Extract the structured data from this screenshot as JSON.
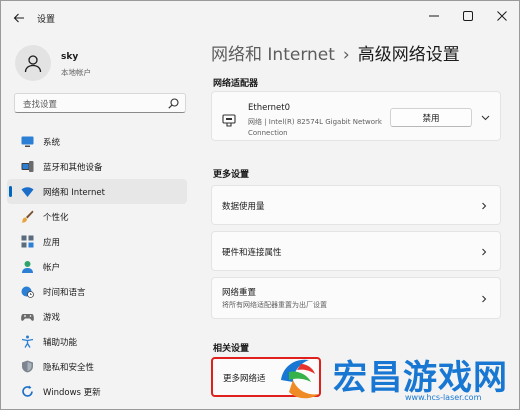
{
  "window": {
    "app_title": "设置"
  },
  "profile": {
    "name": "sky",
    "account_type": "本地帐户"
  },
  "search": {
    "placeholder": "查找设置"
  },
  "sidebar": {
    "items": [
      {
        "label": "系统",
        "icon": "monitor-icon",
        "active": false
      },
      {
        "label": "蓝牙和其他设备",
        "icon": "bluetooth-devices-icon",
        "active": false
      },
      {
        "label": "网络和 Internet",
        "icon": "wifi-icon",
        "active": true
      },
      {
        "label": "个性化",
        "icon": "brush-icon",
        "active": false
      },
      {
        "label": "应用",
        "icon": "apps-icon",
        "active": false
      },
      {
        "label": "帐户",
        "icon": "person-icon",
        "active": false
      },
      {
        "label": "时间和语言",
        "icon": "globe-clock-icon",
        "active": false
      },
      {
        "label": "游戏",
        "icon": "gamepad-icon",
        "active": false
      },
      {
        "label": "辅助功能",
        "icon": "accessibility-icon",
        "active": false
      },
      {
        "label": "隐私和安全性",
        "icon": "shield-icon",
        "active": false
      },
      {
        "label": "Windows 更新",
        "icon": "update-icon",
        "active": false
      }
    ]
  },
  "header": {
    "parent": "网络和 Internet",
    "separator": "›",
    "current": "高级网络设置"
  },
  "adapters": {
    "title": "网络适配器",
    "items": [
      {
        "name": "Ethernet0",
        "description": "网络 | Intel(R) 82574L Gigabit Network Connection",
        "disable_label": "禁用"
      }
    ]
  },
  "more_settings": {
    "title": "更多设置",
    "items": [
      {
        "title": "数据使用量",
        "subtitle": ""
      },
      {
        "title": "硬件和连接属性",
        "subtitle": ""
      },
      {
        "title": "网络重置",
        "subtitle": "将所有网络适配器重置为出厂设置"
      }
    ]
  },
  "related_settings": {
    "title": "相关设置",
    "items": [
      {
        "title": "更多网络适"
      }
    ]
  },
  "watermark": {
    "brand": "宏昌游戏网",
    "url": "www.hcs-laser.com"
  },
  "colors": {
    "accent": "#0067c0",
    "watermark_blue": "#1877d2",
    "highlight_box": "#e0201c"
  }
}
